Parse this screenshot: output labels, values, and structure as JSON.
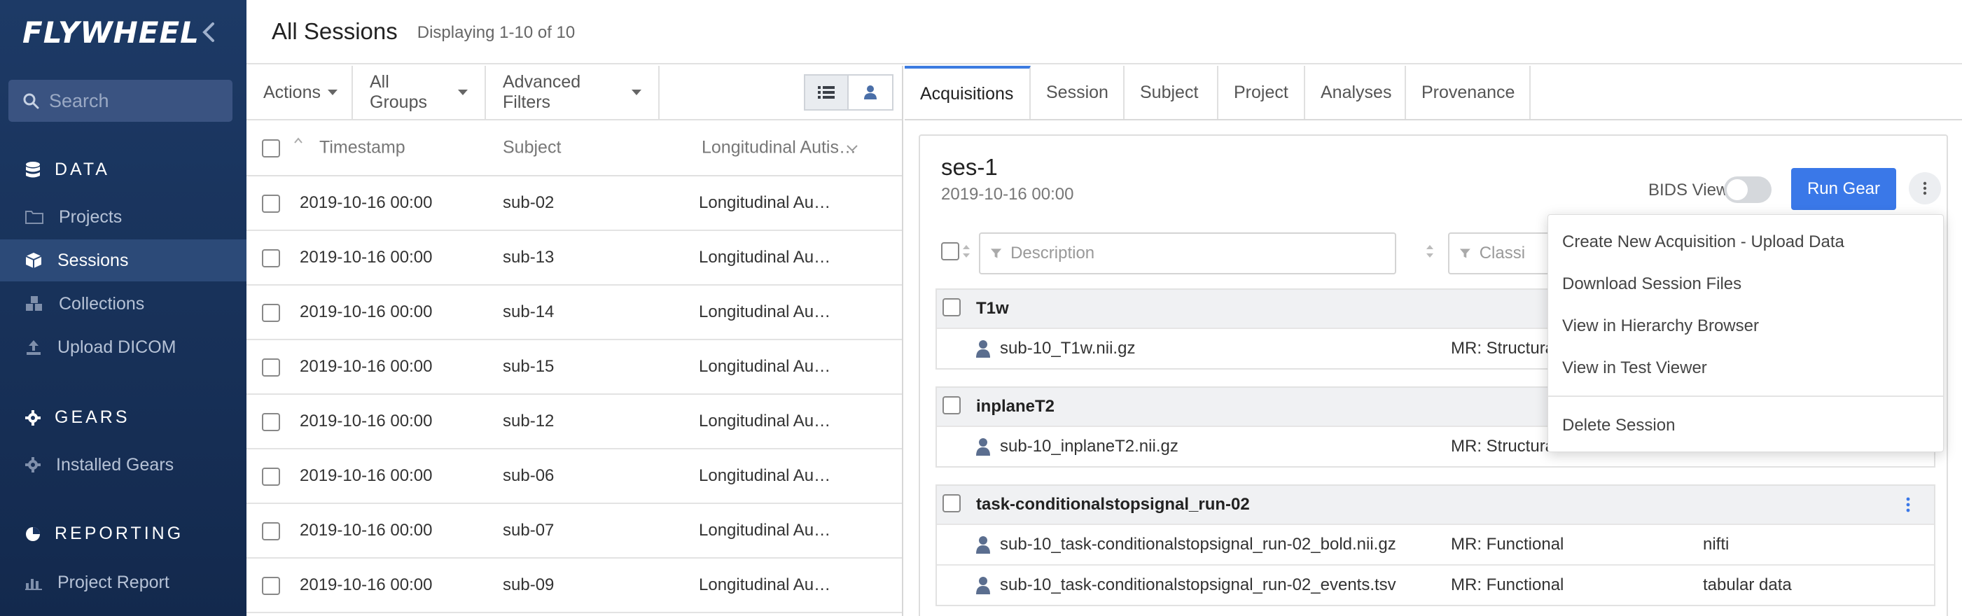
{
  "sidebar": {
    "logo": "FLYWHEEL",
    "search_placeholder": "Search",
    "sections": {
      "data": "DATA",
      "gears": "GEARS",
      "reporting": "REPORTING"
    },
    "items": {
      "projects": "Projects",
      "sessions": "Sessions",
      "collections": "Collections",
      "upload_dicom": "Upload DICOM",
      "installed_gears": "Installed Gears",
      "project_report": "Project Report"
    },
    "active_item": "sessions"
  },
  "header": {
    "title": "All Sessions",
    "count": "Displaying 1-10 of 10"
  },
  "toolbar": {
    "actions": "Actions",
    "groups": "All Groups",
    "filters": "Advanced Filters"
  },
  "list": {
    "columns": [
      "Timestamp",
      "Subject",
      "Longitudinal Autis…"
    ],
    "rows": [
      {
        "timestamp": "2019-10-16 00:00",
        "subject": "sub-02",
        "project": "Longitudinal Au…"
      },
      {
        "timestamp": "2019-10-16 00:00",
        "subject": "sub-13",
        "project": "Longitudinal Au…"
      },
      {
        "timestamp": "2019-10-16 00:00",
        "subject": "sub-14",
        "project": "Longitudinal Au…"
      },
      {
        "timestamp": "2019-10-16 00:00",
        "subject": "sub-15",
        "project": "Longitudinal Au…"
      },
      {
        "timestamp": "2019-10-16 00:00",
        "subject": "sub-12",
        "project": "Longitudinal Au…"
      },
      {
        "timestamp": "2019-10-16 00:00",
        "subject": "sub-06",
        "project": "Longitudinal Au…"
      },
      {
        "timestamp": "2019-10-16 00:00",
        "subject": "sub-07",
        "project": "Longitudinal Au…"
      },
      {
        "timestamp": "2019-10-16 00:00",
        "subject": "sub-09",
        "project": "Longitudinal Au…"
      }
    ]
  },
  "detail": {
    "tabs": [
      "Acquisitions",
      "Session",
      "Subject",
      "Project",
      "Analyses",
      "Provenance"
    ],
    "active_tab": "Acquisitions",
    "session_label": "ses-1",
    "session_date": "2019-10-16 00:00",
    "bids_label": "BIDS View",
    "bids_on": false,
    "run_gear": "Run Gear",
    "filter_description": "Description",
    "filter_classification": "Classi",
    "groups": [
      {
        "name": "T1w",
        "files": [
          {
            "name": "sub-10_T1w.nii.gz",
            "classification": "MR: Structura",
            "type": ""
          }
        ]
      },
      {
        "name": "inplaneT2",
        "files": [
          {
            "name": "sub-10_inplaneT2.nii.gz",
            "classification": "MR: Structura",
            "type": ""
          }
        ]
      },
      {
        "name": "task-conditionalstopsignal_run-02",
        "files": [
          {
            "name": "sub-10_task-conditionalstopsignal_run-02_bold.nii.gz",
            "classification": "MR: Functional",
            "type": "nifti"
          },
          {
            "name": "sub-10_task-conditionalstopsignal_run-02_events.tsv",
            "classification": "MR: Functional",
            "type": "tabular data"
          }
        ]
      }
    ]
  },
  "dropdown": {
    "items": [
      "Create New Acquisition - Upload Data",
      "Download Session Files",
      "View in Hierarchy Browser",
      "View in Test Viewer"
    ],
    "danger_item": "Delete Session"
  },
  "colors": {
    "sidebar_top": "#1d3a66",
    "sidebar_bottom": "#13294d",
    "accent": "#3a78e8",
    "tab_active": "#3c7be0"
  }
}
